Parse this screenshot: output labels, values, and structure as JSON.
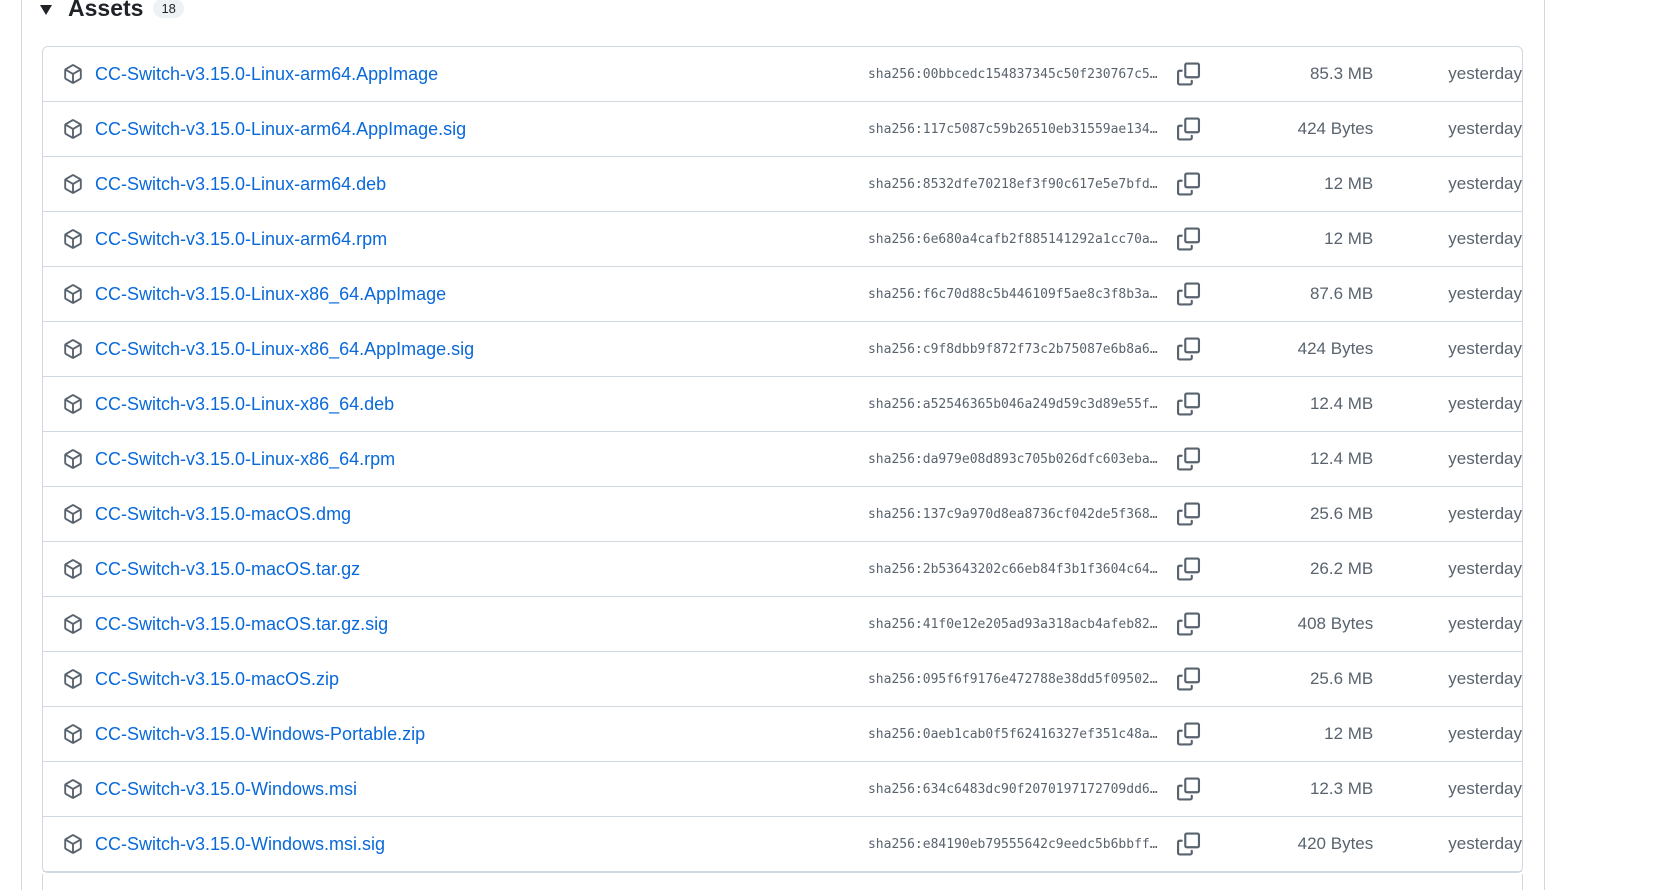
{
  "assets_section": {
    "title": "Assets",
    "count": "18"
  },
  "assets": [
    {
      "name": "CC-Switch-v3.15.0-Linux-arm64.AppImage",
      "sha": "sha256:00bbcedc154837345c50f230767c5…",
      "size": "85.3 MB",
      "date": "yesterday"
    },
    {
      "name": "CC-Switch-v3.15.0-Linux-arm64.AppImage.sig",
      "sha": "sha256:117c5087c59b26510eb31559ae134…",
      "size": "424 Bytes",
      "date": "yesterday"
    },
    {
      "name": "CC-Switch-v3.15.0-Linux-arm64.deb",
      "sha": "sha256:8532dfe70218ef3f90c617e5e7bfd…",
      "size": "12 MB",
      "date": "yesterday"
    },
    {
      "name": "CC-Switch-v3.15.0-Linux-arm64.rpm",
      "sha": "sha256:6e680a4cafb2f885141292a1cc70a…",
      "size": "12 MB",
      "date": "yesterday"
    },
    {
      "name": "CC-Switch-v3.15.0-Linux-x86_64.AppImage",
      "sha": "sha256:f6c70d88c5b446109f5ae8c3f8b3a…",
      "size": "87.6 MB",
      "date": "yesterday"
    },
    {
      "name": "CC-Switch-v3.15.0-Linux-x86_64.AppImage.sig",
      "sha": "sha256:c9f8dbb9f872f73c2b75087e6b8a6…",
      "size": "424 Bytes",
      "date": "yesterday"
    },
    {
      "name": "CC-Switch-v3.15.0-Linux-x86_64.deb",
      "sha": "sha256:a52546365b046a249d59c3d89e55f…",
      "size": "12.4 MB",
      "date": "yesterday"
    },
    {
      "name": "CC-Switch-v3.15.0-Linux-x86_64.rpm",
      "sha": "sha256:da979e08d893c705b026dfc603eba…",
      "size": "12.4 MB",
      "date": "yesterday"
    },
    {
      "name": "CC-Switch-v3.15.0-macOS.dmg",
      "sha": "sha256:137c9a970d8ea8736cf042de5f368…",
      "size": "25.6 MB",
      "date": "yesterday"
    },
    {
      "name": "CC-Switch-v3.15.0-macOS.tar.gz",
      "sha": "sha256:2b53643202c66eb84f3b1f3604c64…",
      "size": "26.2 MB",
      "date": "yesterday"
    },
    {
      "name": "CC-Switch-v3.15.0-macOS.tar.gz.sig",
      "sha": "sha256:41f0e12e205ad93a318acb4afeb82…",
      "size": "408 Bytes",
      "date": "yesterday"
    },
    {
      "name": "CC-Switch-v3.15.0-macOS.zip",
      "sha": "sha256:095f6f9176e472788e38dd5f09502…",
      "size": "25.6 MB",
      "date": "yesterday"
    },
    {
      "name": "CC-Switch-v3.15.0-Windows-Portable.zip",
      "sha": "sha256:0aeb1cab0f5f62416327ef351c48a…",
      "size": "12 MB",
      "date": "yesterday"
    },
    {
      "name": "CC-Switch-v3.15.0-Windows.msi",
      "sha": "sha256:634c6483dc90f2070197172709dd6…",
      "size": "12.3 MB",
      "date": "yesterday"
    },
    {
      "name": "CC-Switch-v3.15.0-Windows.msi.sig",
      "sha": "sha256:e84190eb79555642c9eedc5b6bbff…",
      "size": "420 Bytes",
      "date": "yesterday"
    }
  ],
  "icons": {
    "asset_icon": "package-icon",
    "copy_icon": "copy-icon",
    "toggle_icon": "triangle-down-icon"
  },
  "colors": {
    "link": "#0969da",
    "muted": "#59636e",
    "border": "#d1d9e0"
  }
}
